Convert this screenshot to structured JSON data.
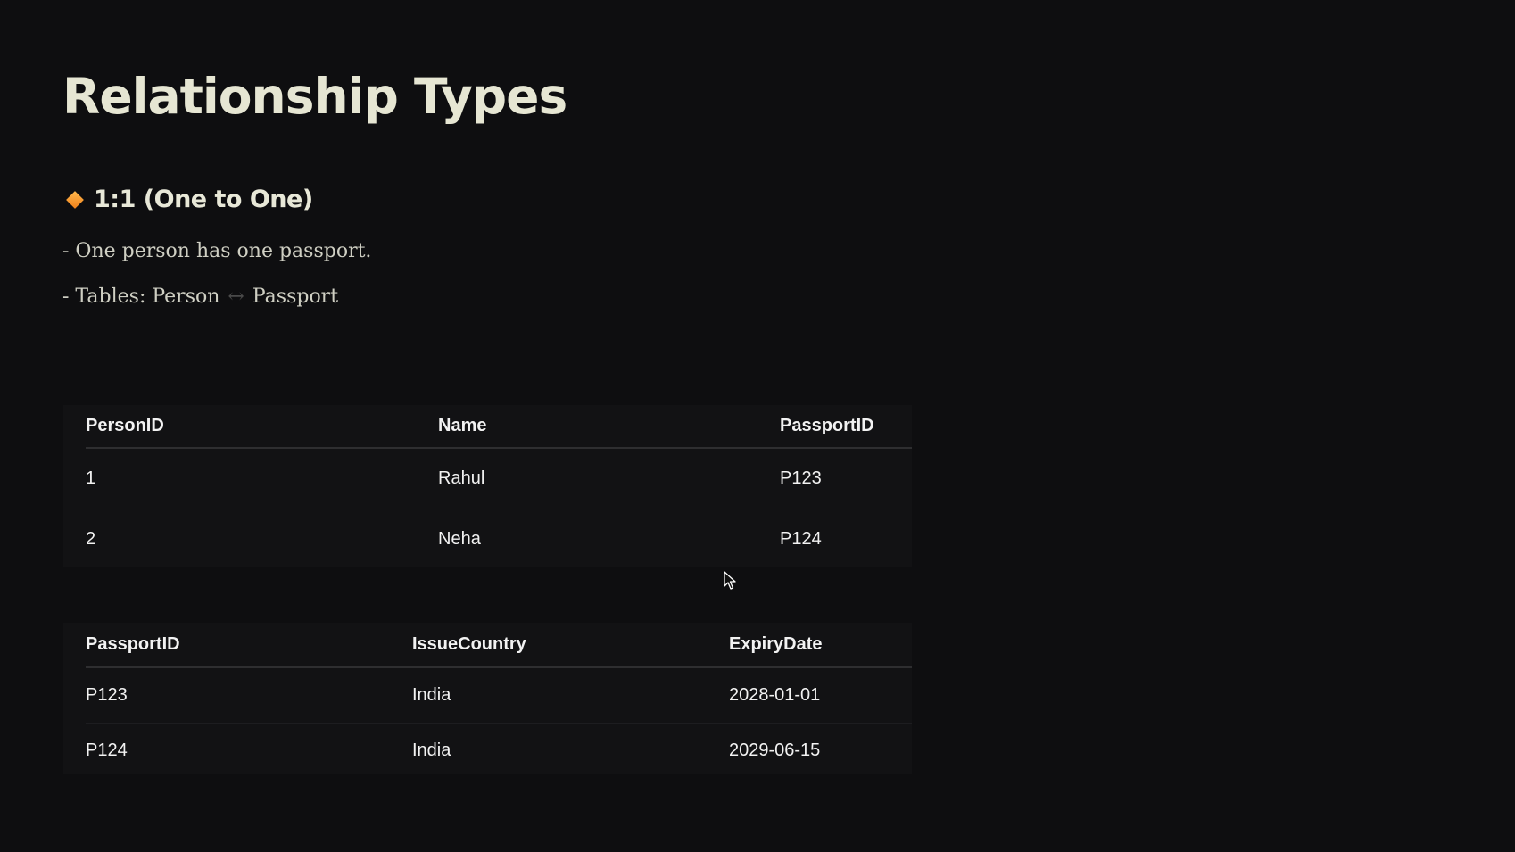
{
  "slide": {
    "title": "Relationship Types",
    "section": {
      "icon": "orange-diamond-icon",
      "heading": "1:1 (One to One)"
    },
    "bullets": {
      "line1": "- One person has one passport.",
      "line2_prefix": "- Tables: Person",
      "line2_arrow": "↔",
      "line2_suffix": "Passport"
    }
  },
  "person_table": {
    "headers": [
      "PersonID",
      "Name",
      "PassportID"
    ],
    "rows": [
      [
        "1",
        "Rahul",
        "P123"
      ],
      [
        "2",
        "Neha",
        "P124"
      ]
    ]
  },
  "passport_table": {
    "headers": [
      "PassportID",
      "IssueCountry",
      "ExpiryDate"
    ],
    "rows": [
      [
        "P123",
        "India",
        "2028-01-01"
      ],
      [
        "P124",
        "India",
        "2029-06-15"
      ]
    ]
  },
  "colors": {
    "background": "#0e0e10",
    "title": "#e6e6d3",
    "accent": "#f0801a",
    "table_bg": "#121214"
  }
}
